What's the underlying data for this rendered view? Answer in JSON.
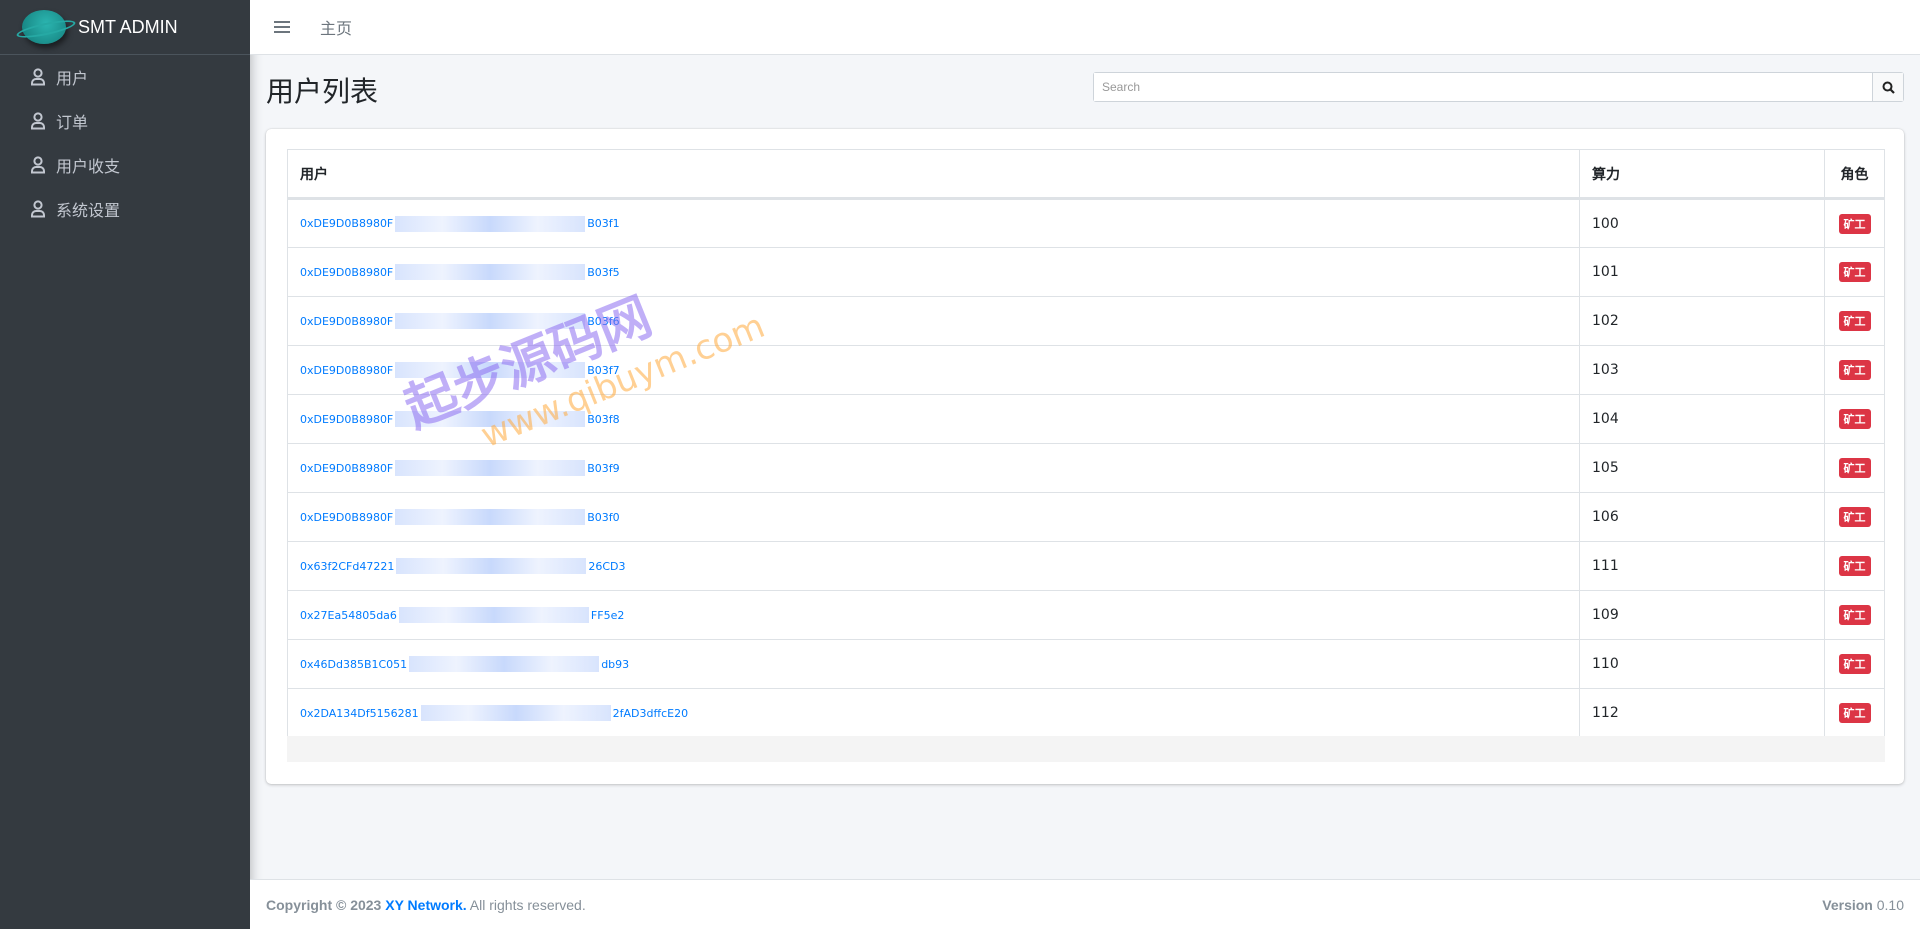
{
  "brand": {
    "name": "SMT ADMIN"
  },
  "sidebar": {
    "items": [
      {
        "label": "用户"
      },
      {
        "label": "订单"
      },
      {
        "label": "用户收支"
      },
      {
        "label": "系统设置"
      }
    ]
  },
  "topbar": {
    "breadcrumb": "主页"
  },
  "page": {
    "title": "用户列表"
  },
  "search": {
    "placeholder": "Search"
  },
  "table": {
    "headers": [
      "用户",
      "算力",
      "角色"
    ],
    "rows": [
      {
        "prefix": "0xDE9D0B8980F",
        "suffix": "B03f1",
        "power": "100",
        "role": "矿工"
      },
      {
        "prefix": "0xDE9D0B8980F",
        "suffix": "B03f5",
        "power": "101",
        "role": "矿工"
      },
      {
        "prefix": "0xDE9D0B8980F",
        "suffix": "B03f6",
        "power": "102",
        "role": "矿工"
      },
      {
        "prefix": "0xDE9D0B8980F",
        "suffix": "B03f7",
        "power": "103",
        "role": "矿工"
      },
      {
        "prefix": "0xDE9D0B8980F",
        "suffix": "B03f8",
        "power": "104",
        "role": "矿工"
      },
      {
        "prefix": "0xDE9D0B8980F",
        "suffix": "B03f9",
        "power": "105",
        "role": "矿工"
      },
      {
        "prefix": "0xDE9D0B8980F",
        "suffix": "B03f0",
        "power": "106",
        "role": "矿工"
      },
      {
        "prefix": "0x63f2CFd47221",
        "suffix": "26CD3",
        "power": "111",
        "role": "矿工"
      },
      {
        "prefix": "0x27Ea54805da6",
        "suffix": "FF5e2",
        "power": "109",
        "role": "矿工"
      },
      {
        "prefix": "0x46Dd385B1C051",
        "suffix": "db93",
        "power": "110",
        "role": "矿工"
      },
      {
        "prefix": "0x2DA134Df5156281",
        "suffix": "2fAD3dffcE20",
        "power": "112",
        "role": "矿工"
      }
    ]
  },
  "watermark": {
    "text": "起步源码网",
    "url": "www.qibuym.com"
  },
  "footer": {
    "copyright": "Copyright © 2023",
    "company": "XY Network.",
    "rights": "All rights reserved.",
    "version_label": "Version",
    "version": "0.10"
  },
  "colors": {
    "accent": "#007bff",
    "badge": "#dc3545",
    "sidebar": "#343a40"
  }
}
